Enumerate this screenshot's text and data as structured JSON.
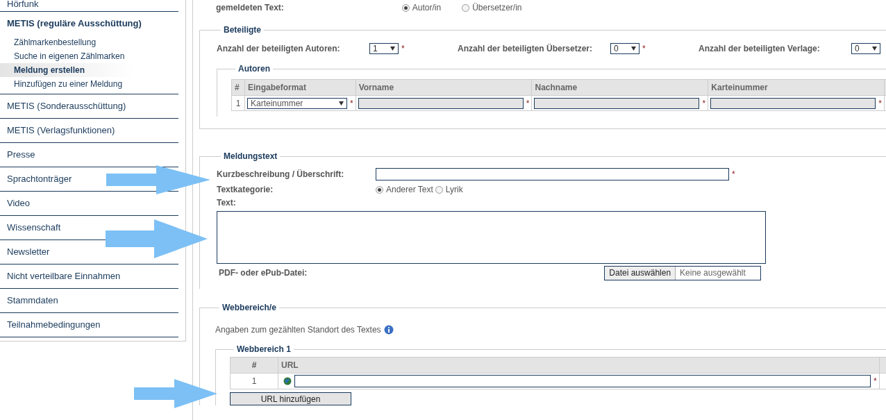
{
  "sidebar": {
    "items": [
      {
        "label": "Hörfunk",
        "selected": false
      },
      {
        "label": "METIS (reguläre Ausschüttung)",
        "selected": true,
        "children": [
          {
            "label": "Zählmarkenbestellung",
            "selected": false
          },
          {
            "label": "Suche in eigenen Zählmarken",
            "selected": false
          },
          {
            "label": "Meldung erstellen",
            "selected": true
          },
          {
            "label": "Hinzufügen zu einer Meldung",
            "selected": false
          }
        ]
      },
      {
        "label": "METIS (Sonderausschüttung)",
        "selected": false
      },
      {
        "label": "METIS (Verlagsfunktionen)",
        "selected": false
      },
      {
        "label": "Presse",
        "selected": false
      },
      {
        "label": "Sprachtonträger",
        "selected": false
      },
      {
        "label": "Video",
        "selected": false
      },
      {
        "label": "Wissenschaft",
        "selected": false
      },
      {
        "label": "Newsletter",
        "selected": false
      },
      {
        "label": "Nicht verteilbare Einnahmen",
        "selected": false
      },
      {
        "label": "Stammdaten",
        "selected": false
      },
      {
        "label": "Teilnahmebedingungen",
        "selected": false
      }
    ]
  },
  "role": {
    "label": "gemeldeten Text:",
    "options": [
      {
        "label": "Autor/in",
        "selected": true
      },
      {
        "label": "Übersetzer/in",
        "selected": false
      }
    ]
  },
  "beteiligte": {
    "legend": "Beteiligte",
    "counts": [
      {
        "label": "Anzahl der beteiligten Autoren:",
        "value": "1",
        "required": "*"
      },
      {
        "label": "Anzahl der beteiligten Übersetzer:",
        "value": "0",
        "required": "*"
      },
      {
        "label": "Anzahl der beteiligten Verlage:",
        "value": "0"
      }
    ],
    "autoren": {
      "legend": "Autoren",
      "columns": [
        "#",
        "Eingabeformat",
        "Vorname",
        "Nachname",
        "Karteinummer"
      ],
      "rows": [
        {
          "index": "1",
          "format": "Karteinummer",
          "required": [
            "*",
            "*",
            "*",
            "*"
          ]
        }
      ]
    }
  },
  "meldungstext": {
    "legend": "Meldungstext",
    "title_label": "Kurzbeschreibung / Überschrift:",
    "title_required": "*",
    "category_label": "Textkategorie:",
    "categories": [
      {
        "label": "Anderer Text",
        "selected": true
      },
      {
        "label": "Lyrik",
        "selected": false
      }
    ],
    "text_label": "Text:",
    "file_label": "PDF- oder ePub-Datei:",
    "file_button": "Datei auswählen",
    "file_status": "Keine ausgewählt"
  },
  "webbereich": {
    "legend": "Webbereich/e",
    "info": "Angaben zum gezählten Standort des Textes",
    "sub_legend": "Webbereich 1",
    "columns": [
      "#",
      "URL"
    ],
    "rows": [
      {
        "index": "1",
        "required": "*"
      }
    ],
    "add_button": "URL hinzufügen"
  }
}
